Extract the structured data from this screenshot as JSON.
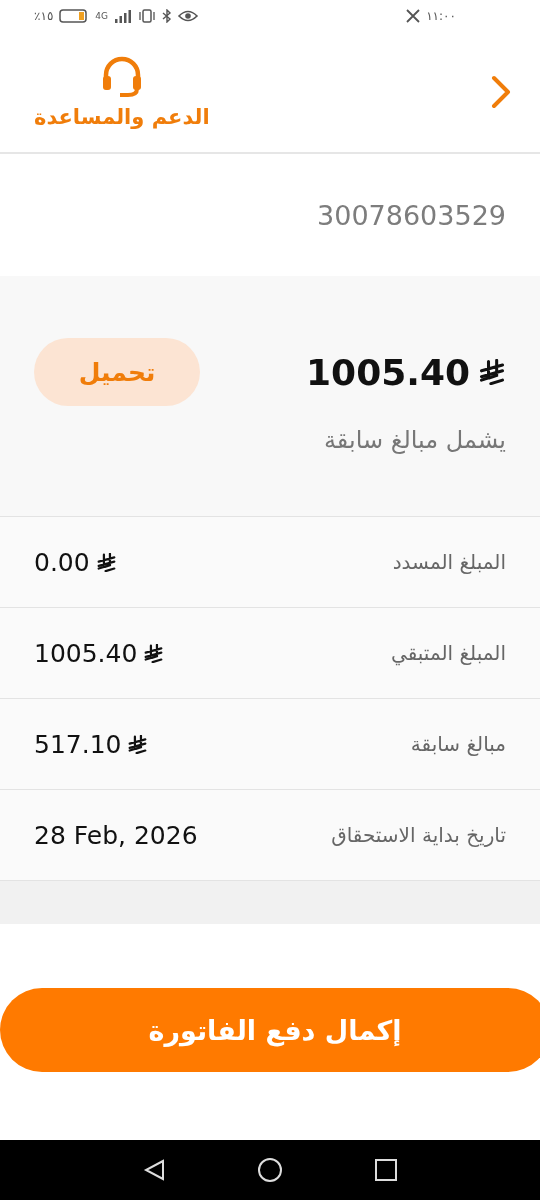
{
  "status_bar": {
    "time": "١١:٠٠",
    "battery": "٪١٥",
    "network": "4G"
  },
  "header": {
    "support_label": "الدعم والمساعدة"
  },
  "account": {
    "number": "30078603529"
  },
  "summary": {
    "amount": "1005.40",
    "note": "يشمل مبالغ سابقة",
    "download_button": "تحميل"
  },
  "details": [
    {
      "label": "المبلغ المسدد",
      "value": "0.00",
      "currency": true
    },
    {
      "label": "المبلغ المتبقي",
      "value": "1005.40",
      "currency": true
    },
    {
      "label": "مبالغ سابقة",
      "value": "517.10",
      "currency": true
    },
    {
      "label": "تاريخ بداية الاستحقاق",
      "value": "28 Feb, 2026",
      "currency": false
    }
  ],
  "pay_button": "إكمال دفع الفاتورة"
}
